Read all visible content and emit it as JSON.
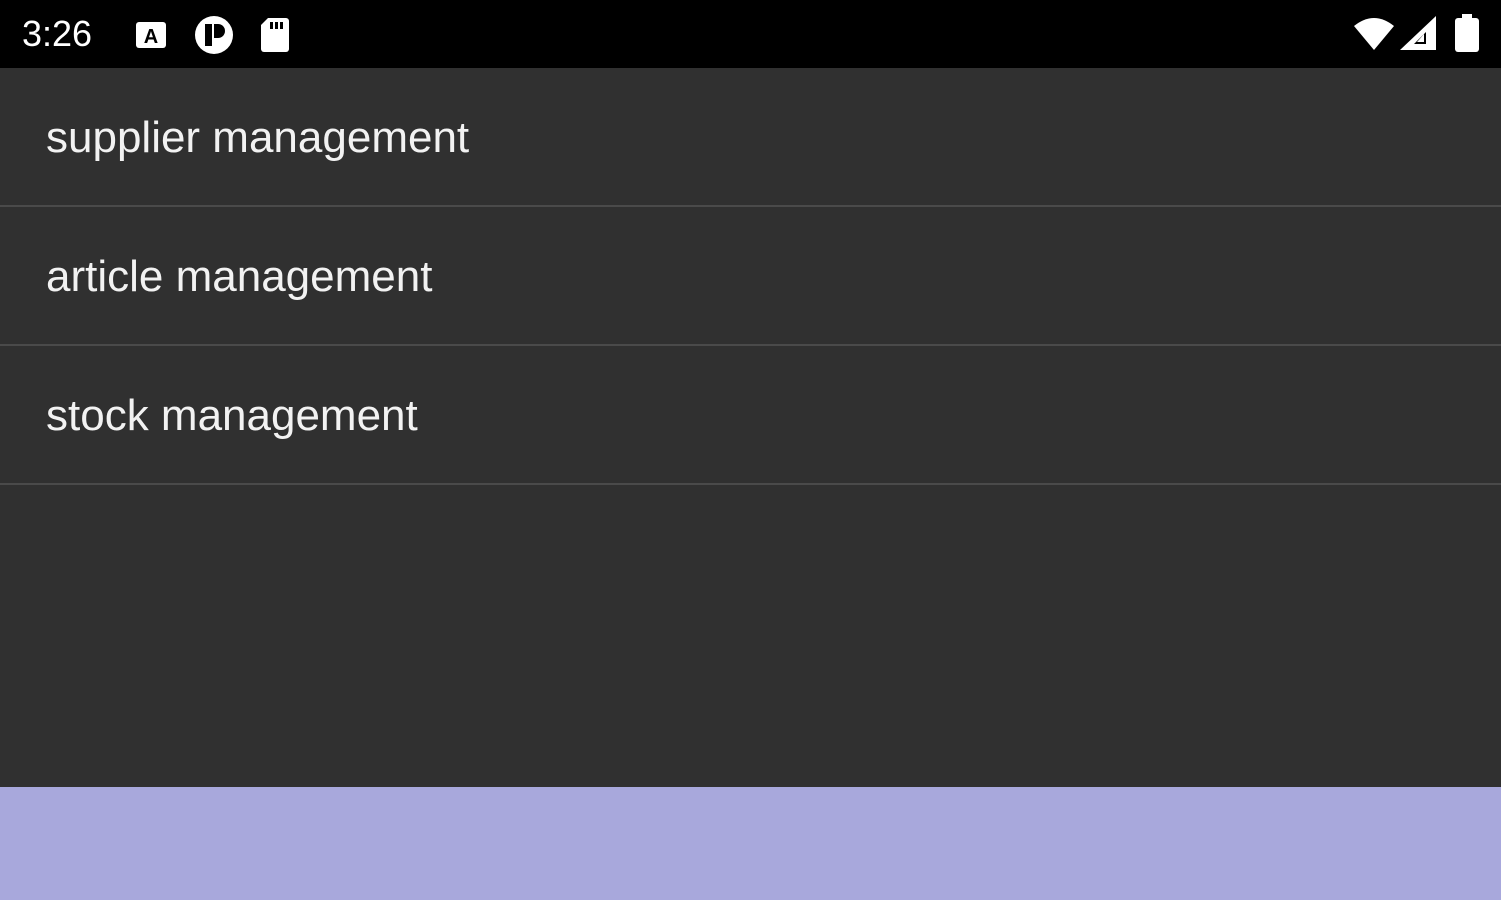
{
  "status_bar": {
    "time": "3:26",
    "icons": [
      "keyboard-a-icon",
      "app-notification-icon",
      "sd-card-icon",
      "wifi-icon",
      "cell-signal-icon",
      "battery-icon"
    ]
  },
  "menu": {
    "items": [
      {
        "label": "supplier management"
      },
      {
        "label": "article management"
      },
      {
        "label": "stock management"
      }
    ]
  },
  "colors": {
    "background": "#303030",
    "status_bar": "#000000",
    "divider": "#4a4a4a",
    "bottom_bar": "#a8a8dc",
    "text": "#f2f2f2"
  }
}
